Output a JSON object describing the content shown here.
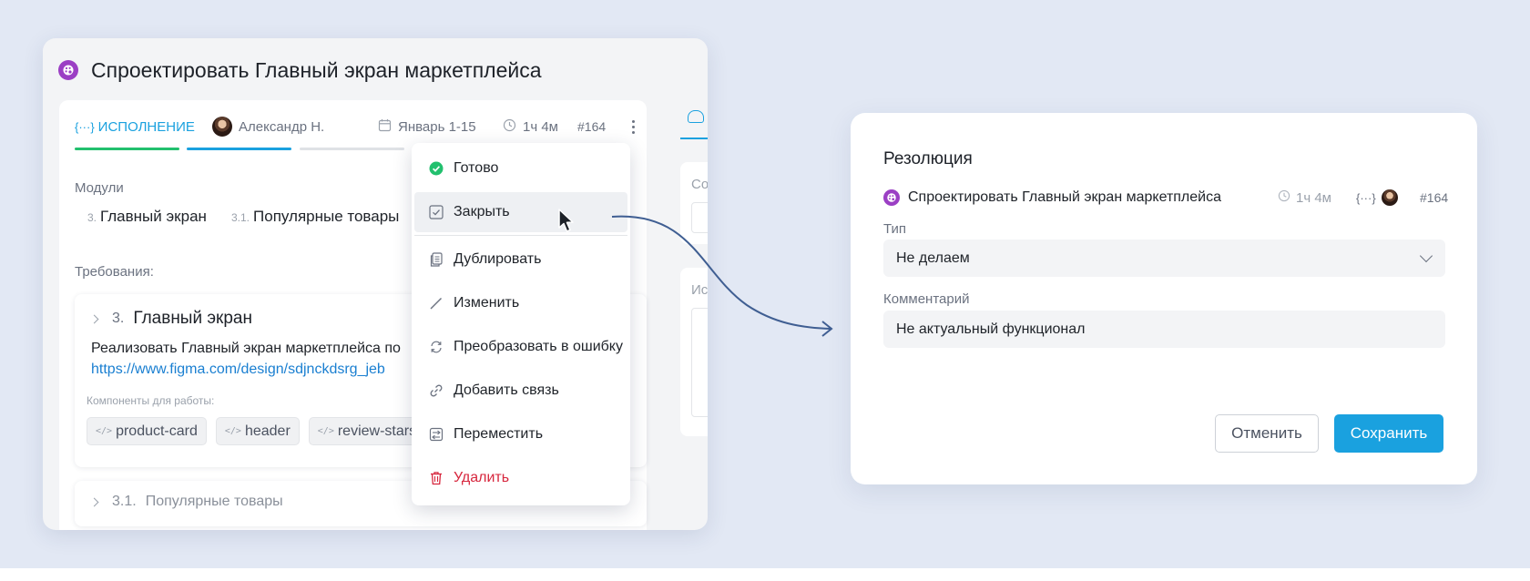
{
  "task": {
    "title": "Спроектировать Главный экран маркетплейса",
    "stage": "ИСПОЛНЕНИЕ",
    "stage_icon": "{···}",
    "assignee": "Александр Н.",
    "date": "Январь 1-15",
    "time": "1ч 4м",
    "number": "#164"
  },
  "modules": {
    "label": "Модули",
    "items": [
      {
        "num": "3.",
        "name": "Главный экран"
      },
      {
        "num": "3.1.",
        "name": "Популярные товары"
      }
    ]
  },
  "requirements": {
    "label": "Требования:",
    "items": [
      {
        "num": "3.",
        "title": "Главный экран",
        "text": "Реализовать Главный экран маркетплейса по",
        "link": "https://www.figma.com/design/sdjnckdsrg_jeb",
        "components_label": "Компоненты для работы:",
        "components": [
          "product-card",
          "header",
          "review-stars"
        ]
      },
      {
        "num": "3.1.",
        "title": "Популярные товары"
      }
    ]
  },
  "side": {
    "panel1_label": "Со",
    "panel2_label": "Ис"
  },
  "menu": {
    "items": [
      {
        "label": "Готово",
        "icon": "check-circle-icon"
      },
      {
        "label": "Закрыть",
        "icon": "checkbox-icon"
      },
      {
        "label": "Дублировать",
        "icon": "copy-icon"
      },
      {
        "label": "Изменить",
        "icon": "pencil-icon"
      },
      {
        "label": "Преобразовать в ошибку",
        "icon": "convert-icon"
      },
      {
        "label": "Добавить связь",
        "icon": "link-icon"
      },
      {
        "label": "Переместить",
        "icon": "move-icon"
      },
      {
        "label": "Удалить",
        "icon": "trash-icon"
      }
    ],
    "hovered_index": 1
  },
  "dialog": {
    "title": "Резолюция",
    "task_name": "Спроектировать Главный экран маркетплейса",
    "time": "1ч 4м",
    "stage_icon": "{···}",
    "number": "#164",
    "type_label": "Тип",
    "type_value": "Не делаем",
    "comment_label": "Комментарий",
    "comment_value": "Не актуальный функционал",
    "cancel_label": "Отменить",
    "save_label": "Сохранить"
  },
  "colors": {
    "accent": "#1aa1df",
    "success": "#22c06e",
    "danger": "#d7263d",
    "brand_icon": "#9b3fc4",
    "background": "#e2e8f4"
  }
}
